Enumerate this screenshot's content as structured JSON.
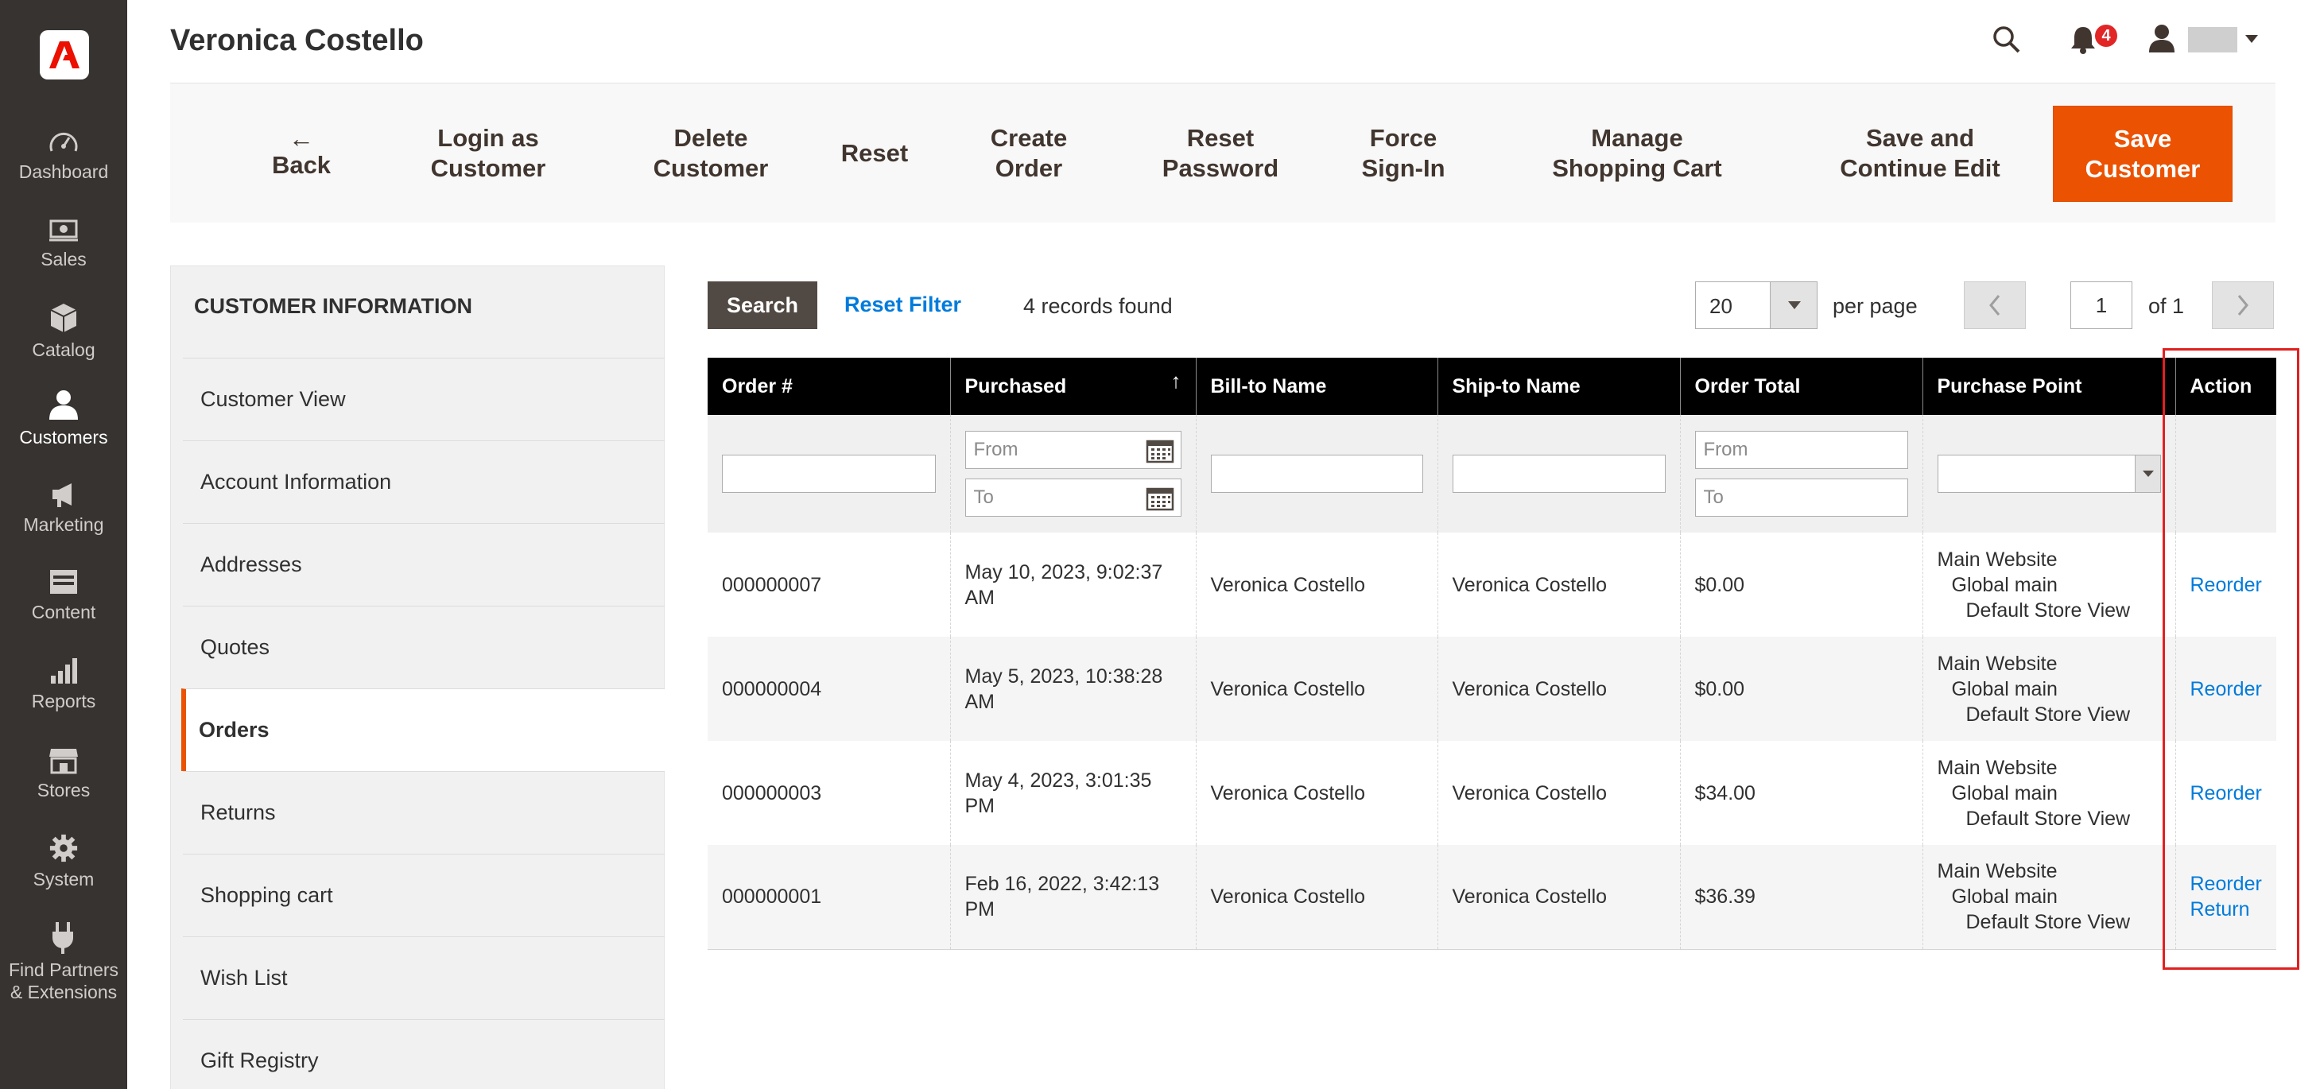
{
  "nav": {
    "items": [
      {
        "label": "Dashboard",
        "icon": "dashboard-icon"
      },
      {
        "label": "Sales",
        "icon": "sales-icon"
      },
      {
        "label": "Catalog",
        "icon": "catalog-icon"
      },
      {
        "label": "Customers",
        "icon": "customers-icon"
      },
      {
        "label": "Marketing",
        "icon": "marketing-icon"
      },
      {
        "label": "Content",
        "icon": "content-icon"
      },
      {
        "label": "Reports",
        "icon": "reports-icon"
      },
      {
        "label": "Stores",
        "icon": "stores-icon"
      },
      {
        "label": "System",
        "icon": "system-icon"
      },
      {
        "label_line1": "Find Partners",
        "label_line2": "& Extensions",
        "icon": "plug-icon"
      }
    ]
  },
  "header": {
    "title": "Veronica Costello",
    "notification_count": "4"
  },
  "toolbar": {
    "back": "Back",
    "login_as_customer_1": "Login as",
    "login_as_customer_2": "Customer",
    "delete_customer_1": "Delete",
    "delete_customer_2": "Customer",
    "reset": "Reset",
    "create_order_1": "Create",
    "create_order_2": "Order",
    "reset_password_1": "Reset",
    "reset_password_2": "Password",
    "force_signin_1": "Force",
    "force_signin_2": "Sign-In",
    "manage_cart_1": "Manage",
    "manage_cart_2": "Shopping Cart",
    "save_continue_1": "Save and",
    "save_continue_2": "Continue Edit",
    "save_customer_1": "Save",
    "save_customer_2": "Customer"
  },
  "tabs": {
    "title": "CUSTOMER INFORMATION",
    "items": [
      "Customer View",
      "Account Information",
      "Addresses",
      "Quotes",
      "Orders",
      "Returns",
      "Shopping cart",
      "Wish List",
      "Gift Registry"
    ],
    "active": "Orders"
  },
  "grid_controls": {
    "search_label": "Search",
    "reset_filter_label": "Reset Filter",
    "records_found": "4 records found",
    "per_page_value": "20",
    "per_page_label": "per page",
    "page_value": "1",
    "page_total": "of 1"
  },
  "columns": [
    "Order #",
    "Purchased",
    "Bill-to Name",
    "Ship-to Name",
    "Order Total",
    "Purchase Point",
    "Action"
  ],
  "filters": {
    "from_placeholder": "From",
    "to_placeholder": "To"
  },
  "orders": [
    {
      "order": "000000007",
      "purchased_1": "May 10, 2023, 9:02:37",
      "purchased_2": "AM",
      "bill_to": "Veronica Costello",
      "ship_to": "Veronica Costello",
      "total": "$0.00",
      "pp_1": "Main Website",
      "pp_2": "Global main",
      "pp_3": "Default Store View",
      "action_1": "Reorder",
      "action_2": ""
    },
    {
      "order": "000000004",
      "purchased_1": "May 5, 2023, 10:38:28",
      "purchased_2": "AM",
      "bill_to": "Veronica Costello",
      "ship_to": "Veronica Costello",
      "total": "$0.00",
      "pp_1": "Main Website",
      "pp_2": "Global main",
      "pp_3": "Default Store View",
      "action_1": "Reorder",
      "action_2": ""
    },
    {
      "order": "000000003",
      "purchased_1": "May 4, 2023, 3:01:35 PM",
      "purchased_2": "",
      "bill_to": "Veronica Costello",
      "ship_to": "Veronica Costello",
      "total": "$34.00",
      "pp_1": "Main Website",
      "pp_2": "Global main",
      "pp_3": "Default Store View",
      "action_1": "Reorder",
      "action_2": ""
    },
    {
      "order": "000000001",
      "purchased_1": "Feb 16, 2022, 3:42:13",
      "purchased_2": "PM",
      "bill_to": "Veronica Costello",
      "ship_to": "Veronica Costello",
      "total": "$36.39",
      "pp_1": "Main Website",
      "pp_2": "Global main",
      "pp_3": "Default Store View",
      "action_1": "Reorder",
      "action_2": "Return"
    }
  ],
  "colors": {
    "nav_bg": "#373330",
    "accent": "#eb5202",
    "link": "#007bdb",
    "highlight": "#e02020"
  }
}
